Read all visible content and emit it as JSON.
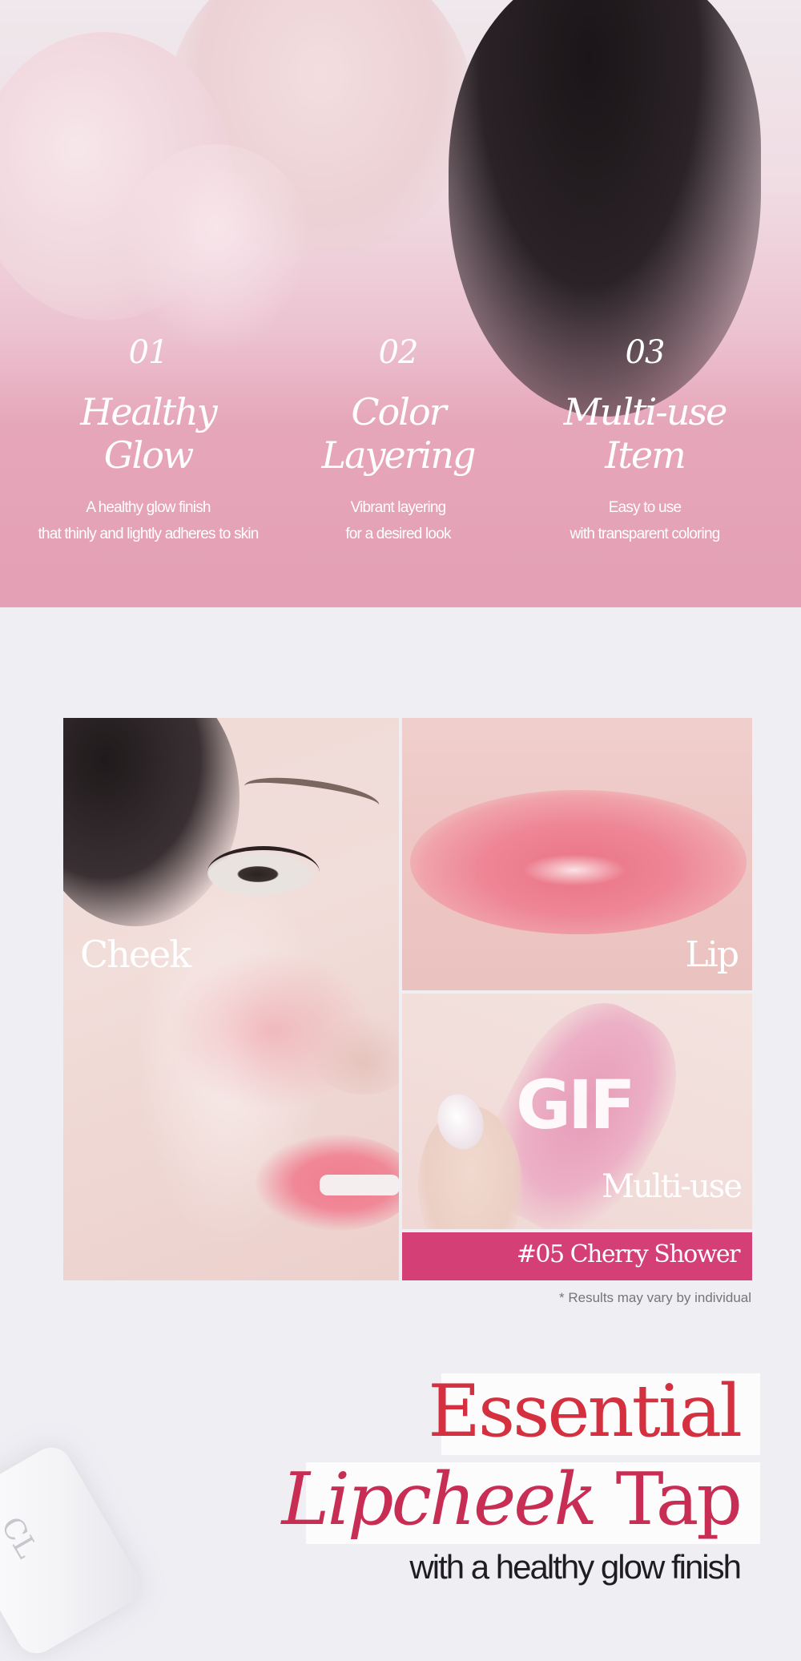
{
  "features": [
    {
      "number": "01",
      "title_line1": "Healthy",
      "title_line2": "Glow",
      "desc_line1": "A healthy glow finish",
      "desc_line2": "that thinly and lightly adheres to skin"
    },
    {
      "number": "02",
      "title_line1": "Color",
      "title_line2": "Layering",
      "desc_line1": "Vibrant layering",
      "desc_line2": "for a desired look"
    },
    {
      "number": "03",
      "title_line1": "Multi-use",
      "title_line2": "Item",
      "desc_line1": "Easy to use",
      "desc_line2": "with transparent coloring"
    }
  ],
  "collage": {
    "cheek_label": "Cheek",
    "lip_label": "Lip",
    "gif_label": "GIF",
    "multi_label": "Multi-use",
    "shade_label": "#05 Cherry Shower",
    "shade_color": "#d43f76"
  },
  "disclaimer": "* Results may vary by individual",
  "headline": {
    "line1": "Essential",
    "line2_italic": "Lipcheek",
    "line2_rest": " Tap",
    "subtitle": "with a healthy glow finish",
    "color": "#d4303f"
  },
  "product_text": "CL"
}
